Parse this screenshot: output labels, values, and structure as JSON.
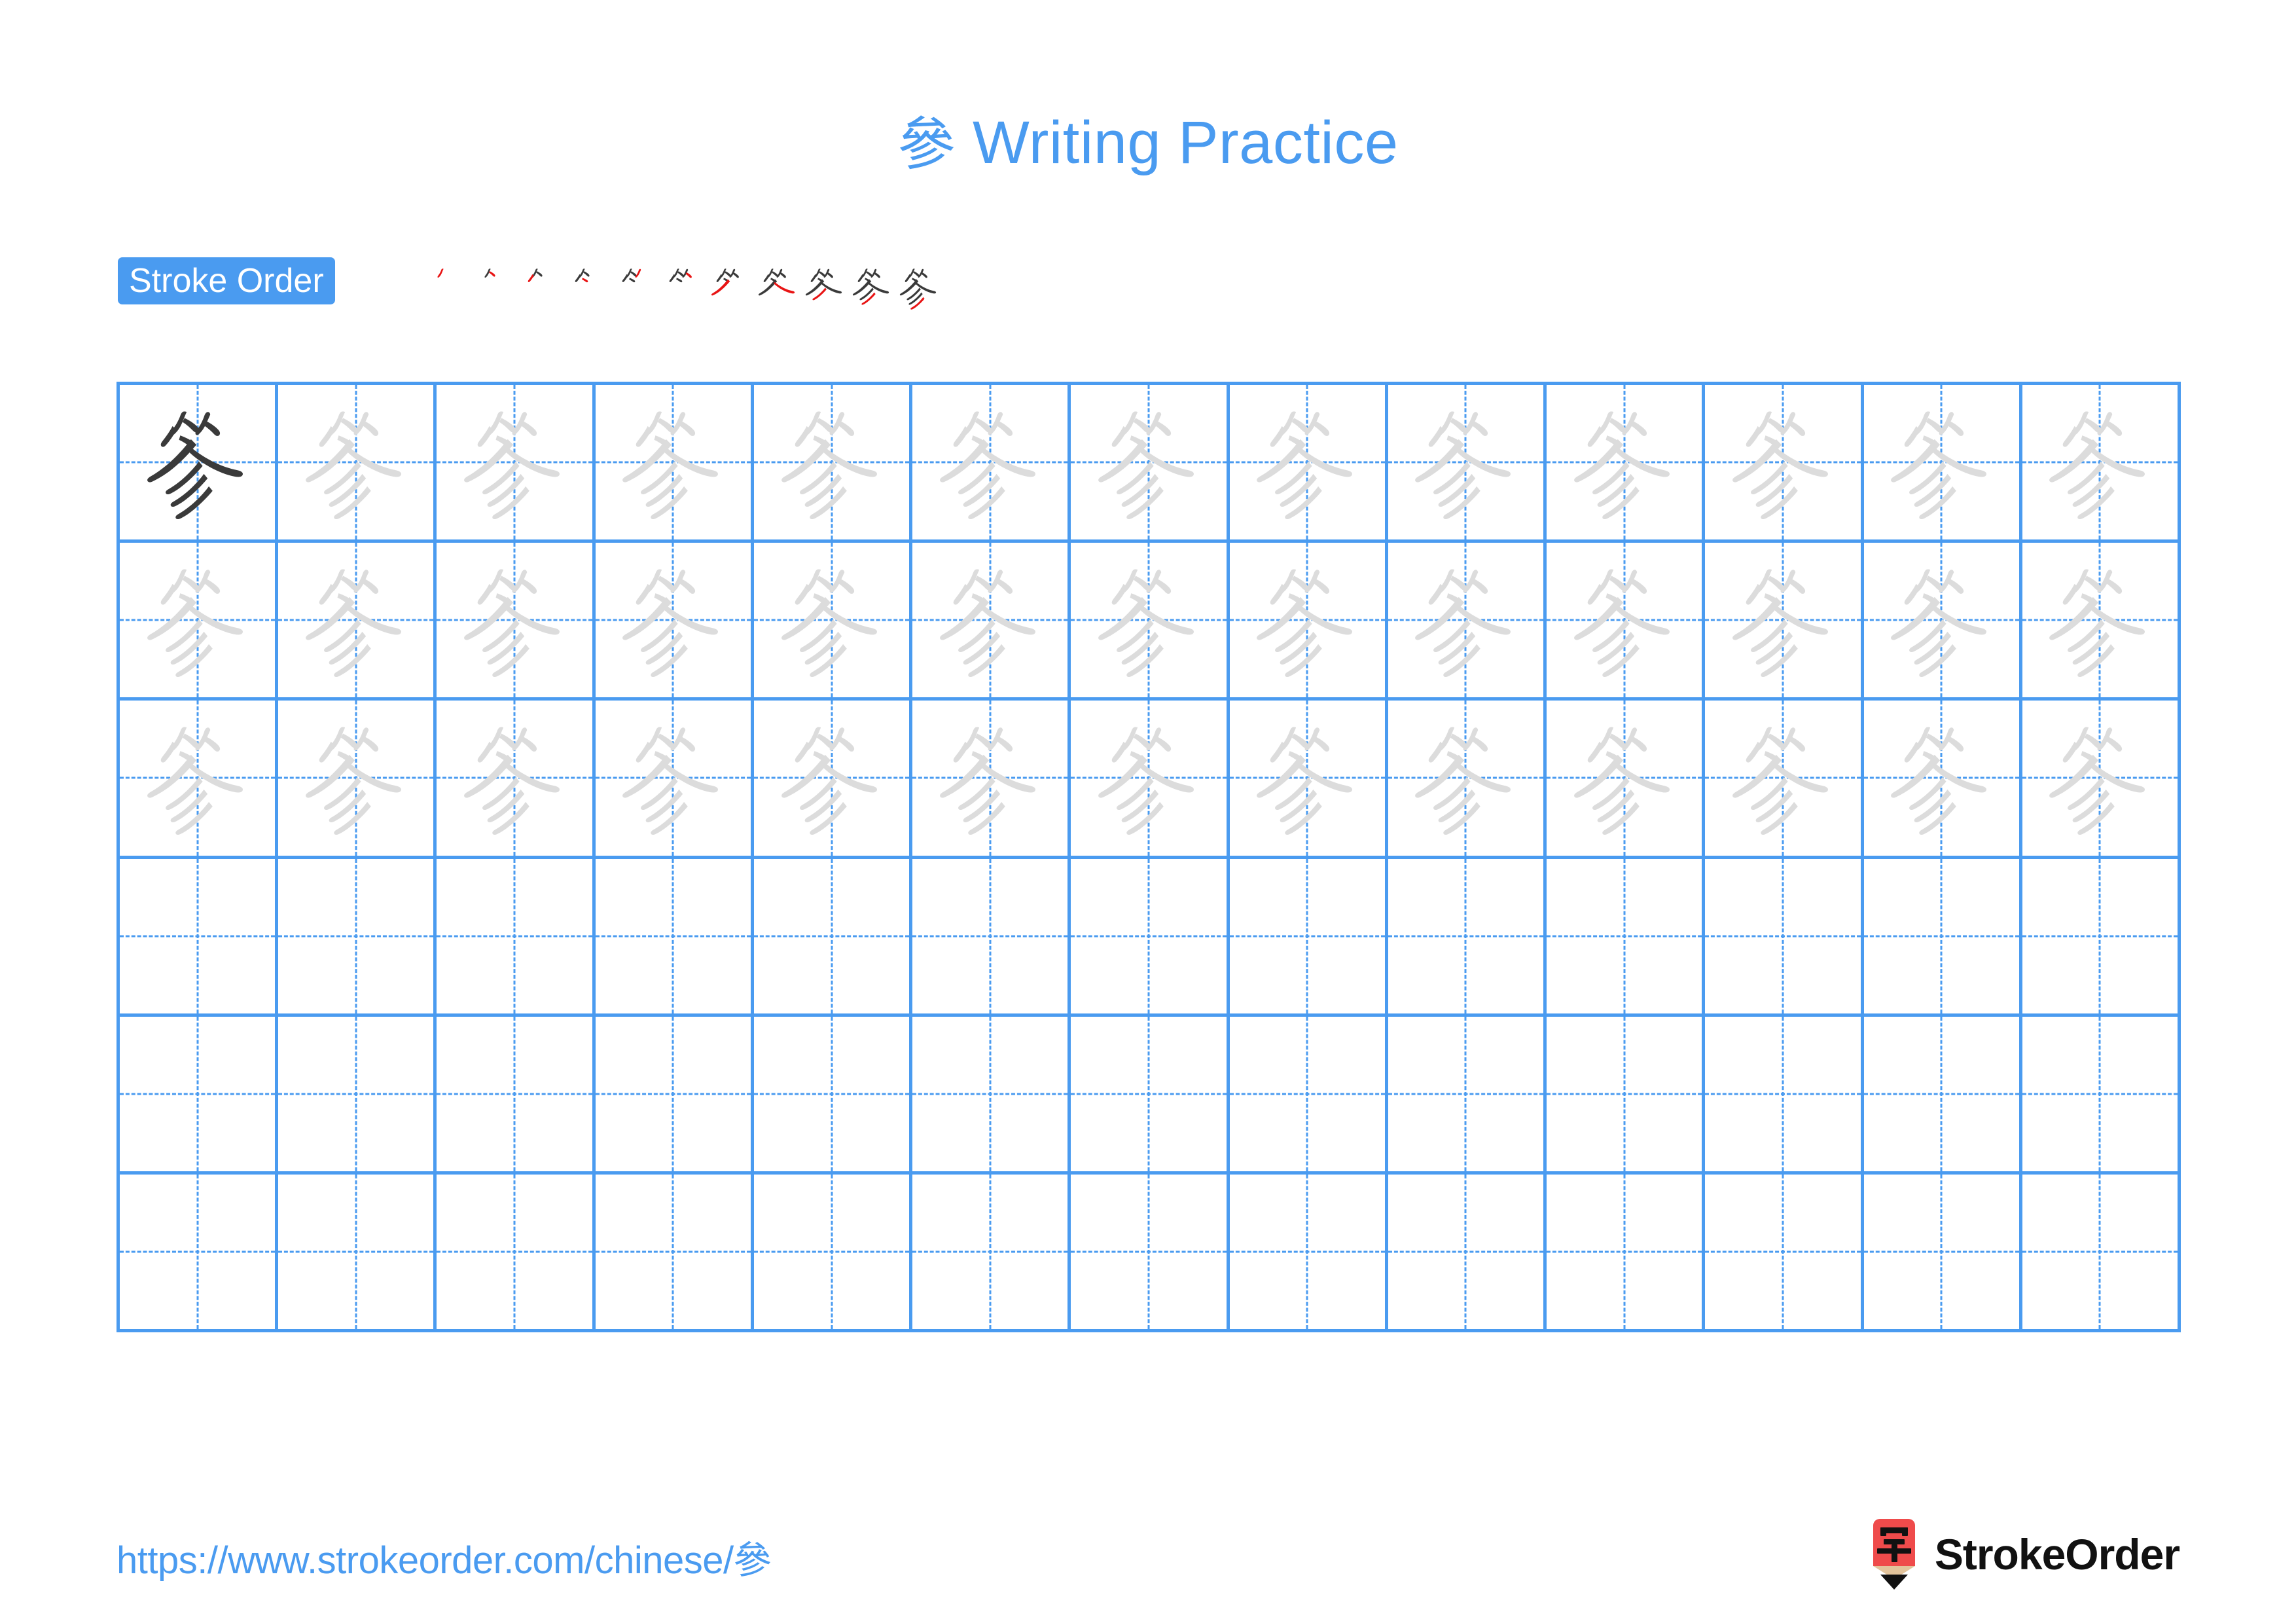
{
  "character": "參",
  "title": {
    "character": "參",
    "text": " Writing Practice",
    "full": "參 Writing Practice",
    "color": "#4a9bf0"
  },
  "stroke_order": {
    "label": "Stroke Order",
    "badge_bg": "#4a9bf0",
    "badge_text_color": "#ffffff",
    "total_strokes": 11,
    "new_stroke_color": "#e81414",
    "existing_stroke_color": "#3a3a3a",
    "steps": [
      1,
      2,
      3,
      4,
      5,
      6,
      7,
      8,
      9,
      10,
      11
    ]
  },
  "grid": {
    "columns": 13,
    "rows": 6,
    "line_color": "#4a9bf0",
    "guide_line_style": "dashed",
    "model_char_color": "#3a3a3a",
    "trace_char_color": "#dcdcdc",
    "filled_rows": 3,
    "empty_rows": 3,
    "model_cell": {
      "row": 1,
      "column": 1
    }
  },
  "footer": {
    "url": "https://www.strokeorder.com/chinese/參",
    "url_color": "#4a9bf0",
    "brand_name": "StrokeOrder",
    "brand_mark_character": "字",
    "brand_mark_color": "#ef4b4b",
    "brand_mark_wood_color": "#e3c49c",
    "brand_mark_tip_color": "#111111"
  }
}
